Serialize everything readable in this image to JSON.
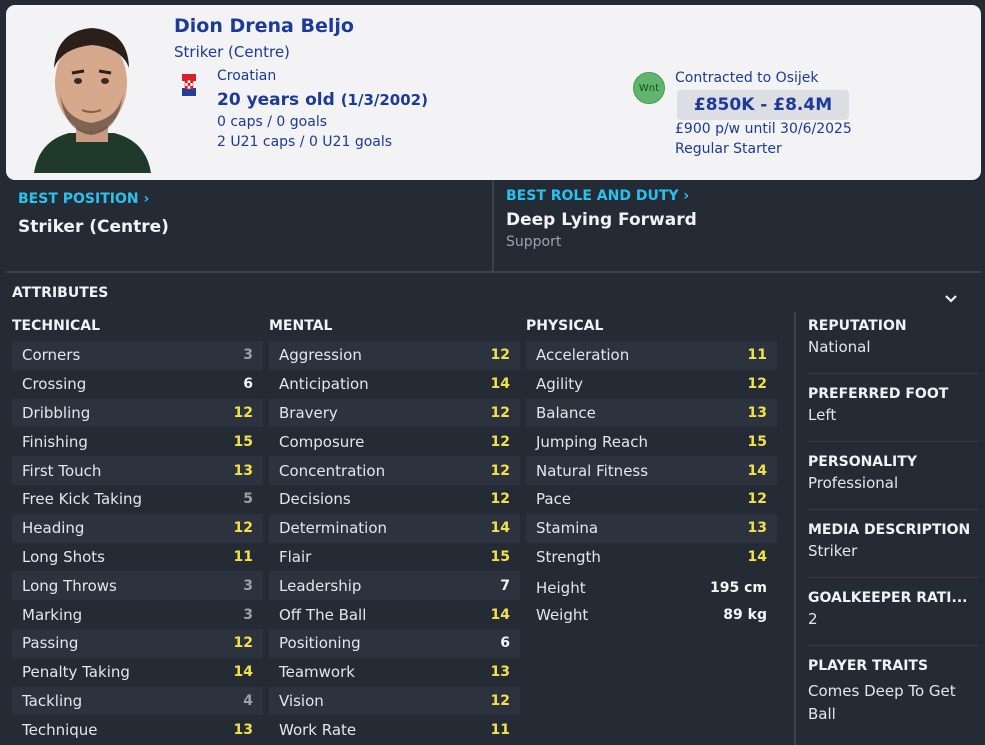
{
  "player": {
    "name": "Dion Drena Beljo",
    "position": "Striker (Centre)",
    "nationality": "Croatian",
    "age_text": "20 years old",
    "dob_text": "(1/3/2002)",
    "caps": "0 caps / 0 goals",
    "u21_caps": "2 U21 caps / 0 U21 goals"
  },
  "contract": {
    "badge": "Wnt",
    "club_text": "Contracted to Osijek",
    "value_range": "£850K - £8.4M",
    "wage_text": "£900 p/w until 30/6/2025",
    "status": "Regular Starter"
  },
  "best": {
    "position_label": "BEST POSITION",
    "position_value": "Striker (Centre)",
    "role_label": "BEST ROLE AND DUTY",
    "role_value": "Deep Lying Forward",
    "role_duty": "Support"
  },
  "attributes_title": "ATTRIBUTES",
  "technical": {
    "title": "TECHNICAL",
    "items": [
      {
        "name": "Corners",
        "value": "3"
      },
      {
        "name": "Crossing",
        "value": "6"
      },
      {
        "name": "Dribbling",
        "value": "12"
      },
      {
        "name": "Finishing",
        "value": "15"
      },
      {
        "name": "First Touch",
        "value": "13"
      },
      {
        "name": "Free Kick Taking",
        "value": "5"
      },
      {
        "name": "Heading",
        "value": "12"
      },
      {
        "name": "Long Shots",
        "value": "11"
      },
      {
        "name": "Long Throws",
        "value": "3"
      },
      {
        "name": "Marking",
        "value": "3"
      },
      {
        "name": "Passing",
        "value": "12"
      },
      {
        "name": "Penalty Taking",
        "value": "14"
      },
      {
        "name": "Tackling",
        "value": "4"
      },
      {
        "name": "Technique",
        "value": "13"
      }
    ]
  },
  "mental": {
    "title": "MENTAL",
    "items": [
      {
        "name": "Aggression",
        "value": "12"
      },
      {
        "name": "Anticipation",
        "value": "14"
      },
      {
        "name": "Bravery",
        "value": "12"
      },
      {
        "name": "Composure",
        "value": "12"
      },
      {
        "name": "Concentration",
        "value": "12"
      },
      {
        "name": "Decisions",
        "value": "12"
      },
      {
        "name": "Determination",
        "value": "14"
      },
      {
        "name": "Flair",
        "value": "15"
      },
      {
        "name": "Leadership",
        "value": "7"
      },
      {
        "name": "Off The Ball",
        "value": "14"
      },
      {
        "name": "Positioning",
        "value": "6"
      },
      {
        "name": "Teamwork",
        "value": "13"
      },
      {
        "name": "Vision",
        "value": "12"
      },
      {
        "name": "Work Rate",
        "value": "11"
      }
    ]
  },
  "physical": {
    "title": "PHYSICAL",
    "items": [
      {
        "name": "Acceleration",
        "value": "11"
      },
      {
        "name": "Agility",
        "value": "12"
      },
      {
        "name": "Balance",
        "value": "13"
      },
      {
        "name": "Jumping Reach",
        "value": "15"
      },
      {
        "name": "Natural Fitness",
        "value": "14"
      },
      {
        "name": "Pace",
        "value": "12"
      },
      {
        "name": "Stamina",
        "value": "13"
      },
      {
        "name": "Strength",
        "value": "14"
      }
    ],
    "height_label": "Height",
    "height_value": "195 cm",
    "weight_label": "Weight",
    "weight_value": "89 kg"
  },
  "sidebar": [
    {
      "title": "REPUTATION",
      "value": "National"
    },
    {
      "title": "PREFERRED FOOT",
      "value": "Left"
    },
    {
      "title": "PERSONALITY",
      "value": "Professional"
    },
    {
      "title": "MEDIA DESCRIPTION",
      "value": "Striker"
    },
    {
      "title": "GOALKEEPER RATI...",
      "value": "2"
    },
    {
      "title": "PLAYER TRAITS",
      "value": "Comes Deep To Get Ball"
    }
  ],
  "colors": {
    "accent": "#28c3ec",
    "header_text": "#1b3a99",
    "value_high": "#f2e24a",
    "value_mid": "#f5f6f8",
    "value_low": "#9aa1ad"
  }
}
